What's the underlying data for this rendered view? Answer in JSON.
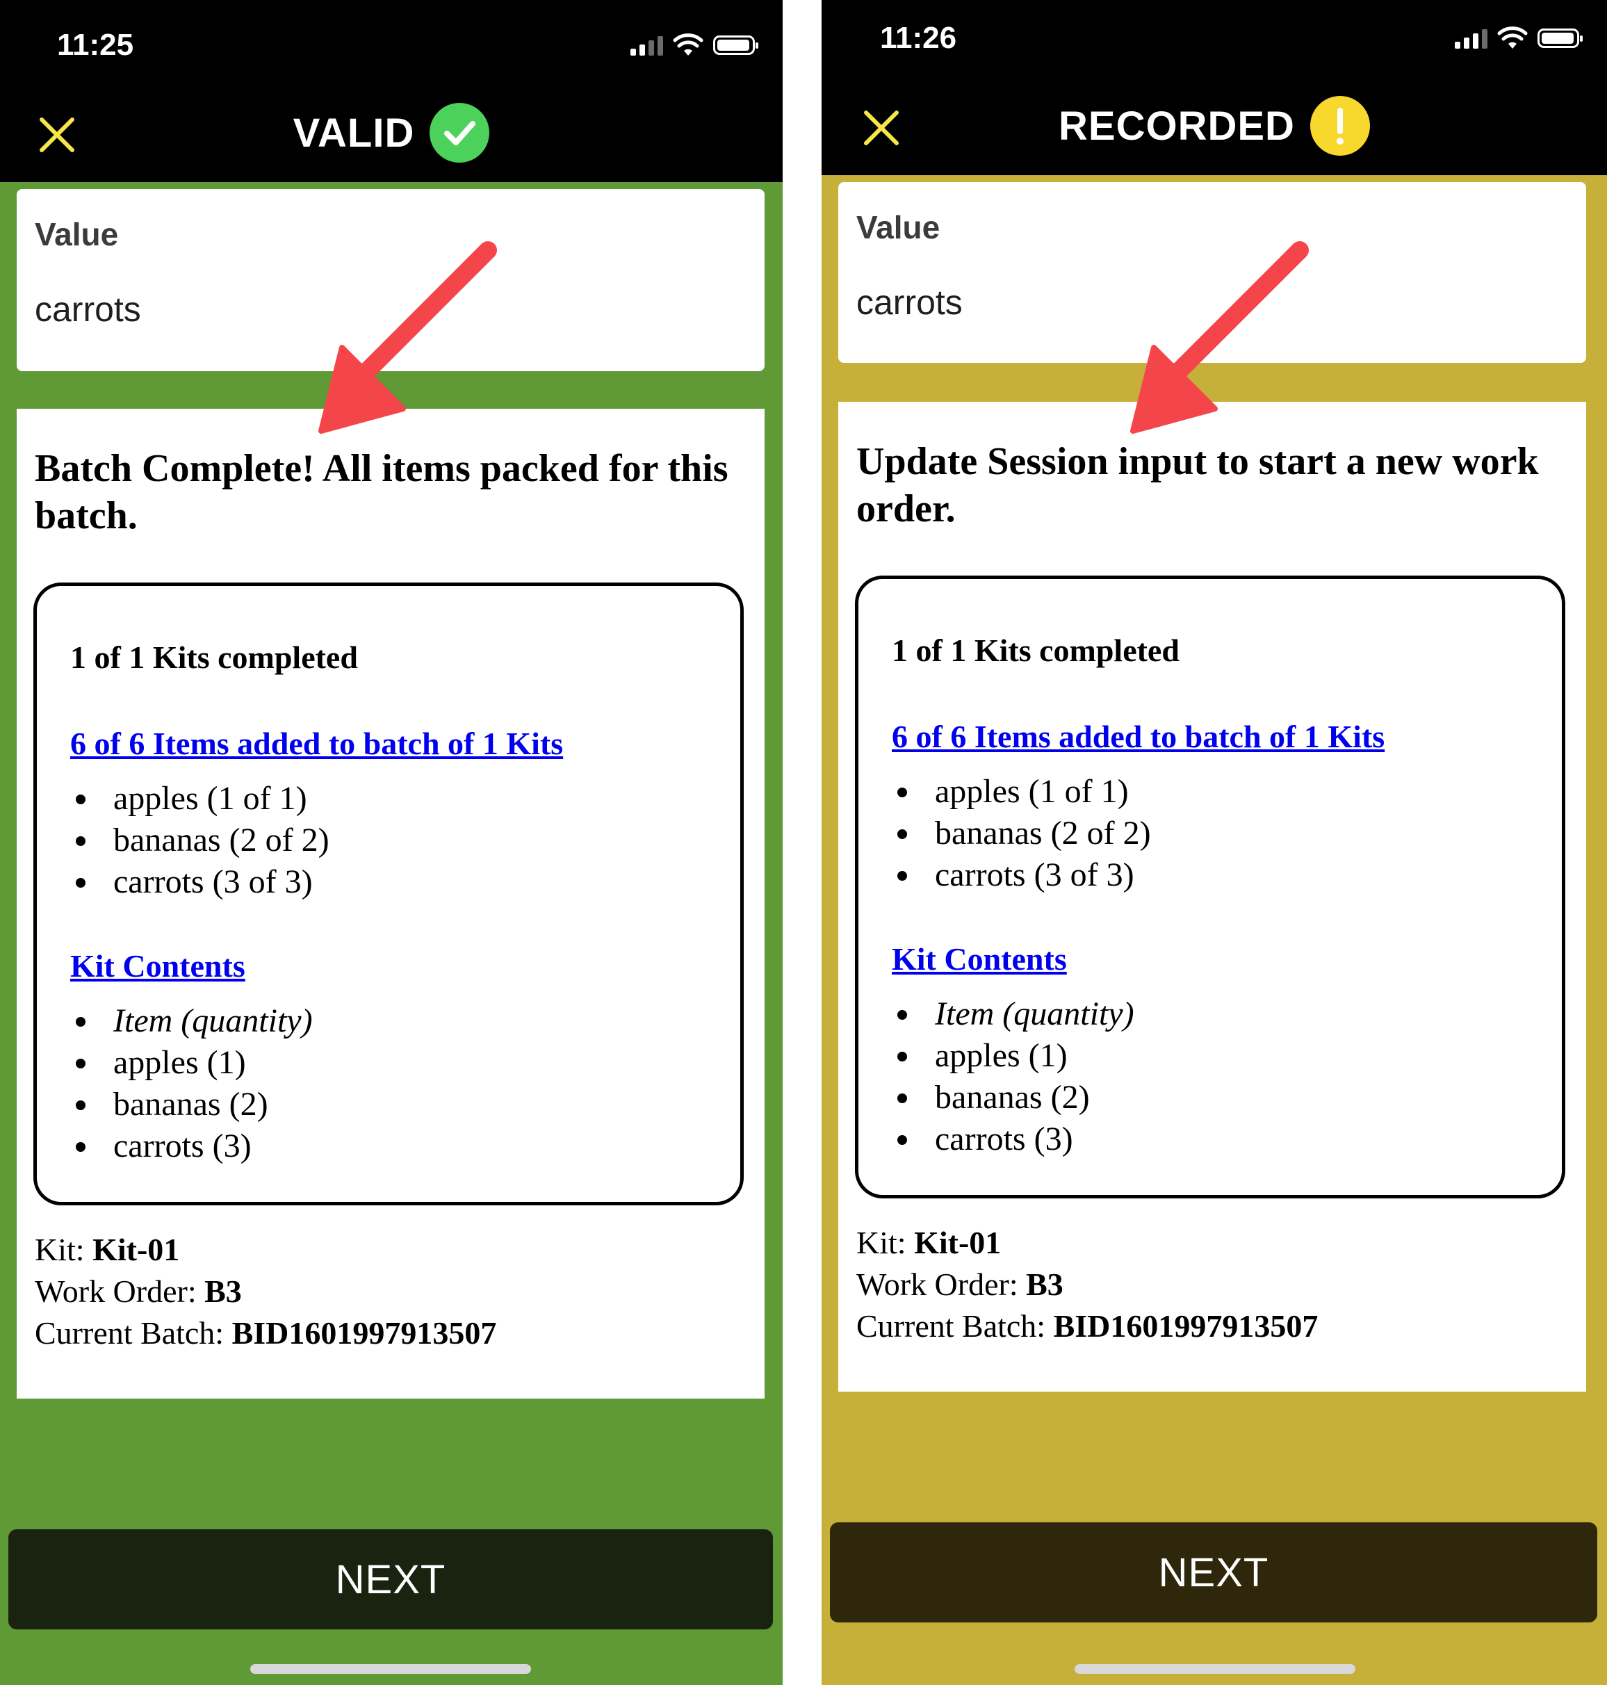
{
  "screens": [
    {
      "status_bar": {
        "time": "11:25"
      },
      "header": {
        "title": "VALID",
        "badge_icon": "checkmark-circle-icon",
        "badge_color": "#4cd15b"
      },
      "background_color": "#5f9a37",
      "value_card": {
        "label": "Value",
        "value": "carrots"
      },
      "message": "Batch Complete! All items packed for this batch.",
      "summary": {
        "kits_completed": "1 of 1 Kits completed",
        "items_link": "6 of 6 Items added to batch of 1 Kits",
        "added_items": [
          "apples (1 of 1)",
          "bananas (2 of 2)",
          "carrots (3 of 3)"
        ],
        "contents_link": "Kit Contents",
        "contents_header": "Item (quantity)",
        "contents_items": [
          "apples (1)",
          "bananas (2)",
          "carrots (3)"
        ]
      },
      "meta": {
        "kit_label": "Kit: ",
        "kit_value": "Kit-01",
        "work_order_label": "Work Order: ",
        "work_order_value": "B3",
        "batch_label": "Current Batch: ",
        "batch_value": "BID1601997913507"
      },
      "next_label": "NEXT"
    },
    {
      "status_bar": {
        "time": "11:26"
      },
      "header": {
        "title": "RECORDED",
        "badge_icon": "exclamation-circle-icon",
        "badge_color": "#f9d82d"
      },
      "background_color": "#c6b03a",
      "value_card": {
        "label": "Value",
        "value": "carrots"
      },
      "message": "Update Session input to start a new work order.",
      "summary": {
        "kits_completed": "1 of 1 Kits completed",
        "items_link": "6 of 6 Items added to batch of 1 Kits",
        "added_items": [
          "apples (1 of 1)",
          "bananas (2 of 2)",
          "carrots (3 of 3)"
        ],
        "contents_link": "Kit Contents",
        "contents_header": "Item (quantity)",
        "contents_items": [
          "apples (1)",
          "bananas (2)",
          "carrots (3)"
        ]
      },
      "meta": {
        "kit_label": "Kit: ",
        "kit_value": "Kit-01",
        "work_order_label": "Work Order: ",
        "work_order_value": "B3",
        "batch_label": "Current Batch: ",
        "batch_value": "BID1601997913507"
      },
      "next_label": "NEXT"
    }
  ],
  "annotation_color": "#f4464a"
}
